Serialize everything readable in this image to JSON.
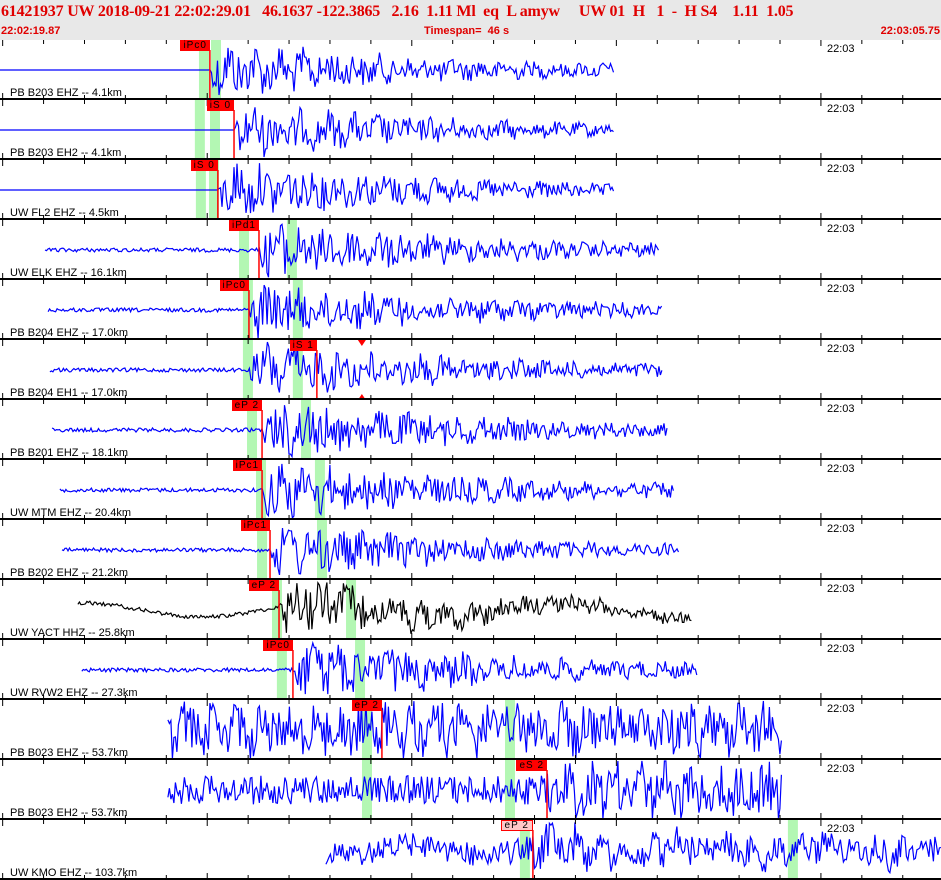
{
  "header": {
    "title": "61421937 UW 2018-09-21 22:02:29.01   46.1637 -122.3865   2.16  1.11 Ml  eq  L amyw     UW 01  H   1  -  H S4    1.11  1.05",
    "start_time": "22:02:19.87",
    "timespan": "Timespan=  46 s",
    "end_time": "22:03:05.75"
  },
  "timespan_s": 46,
  "time_label": "22:03",
  "colors": {
    "trace": "#0000ff",
    "trace_alt": "#000000",
    "pick": "#ff0000",
    "window": "#b3f7b3",
    "header_text": "#e00000"
  },
  "panels": [
    {
      "label": "PB B203 EHZ -- 4.1km",
      "pick": "iPc0",
      "pick_t": 10.26,
      "windows": [
        9.97,
        10.56
      ],
      "trace": [
        0,
        30.05
      ],
      "onset": 10.26,
      "amp": 26,
      "color": "trace"
    },
    {
      "label": "PB B203 EH2 -- 4.1km",
      "pick": "iS 0",
      "pick_t": 11.44,
      "windows": [
        9.77,
        10.51
      ],
      "trace": [
        0,
        30.05
      ],
      "onset": 11.44,
      "amp": 24,
      "color": "trace",
      "triangle": true
    },
    {
      "label": "UW FL2 EHZ -- 4.5km",
      "pick": "iS 0",
      "pick_t": 10.65,
      "windows": [
        9.82,
        10.46
      ],
      "trace": [
        0,
        30.05
      ],
      "onset": 10.65,
      "amp": 26,
      "color": "trace"
    },
    {
      "label": "UW ELK EHZ -- 16.1km",
      "pick": "iPd1",
      "pick_t": 12.66,
      "windows": [
        11.93,
        14.27
      ],
      "trace": [
        2.2,
        32.26
      ],
      "onset": 12.66,
      "amp": 26,
      "color": "trace"
    },
    {
      "label": "PB B204 EHZ -- 17.0km",
      "pick": "iPc0",
      "pick_t": 12.17,
      "windows": [
        12.12,
        14.56
      ],
      "trace": [
        2.35,
        32.36
      ],
      "onset": 12.17,
      "amp": 26,
      "color": "trace"
    },
    {
      "label": "PB B204 EH1 -- 17.0km",
      "pick": "iS 1",
      "pick_t": 15.49,
      "windows": [
        12.12,
        14.56
      ],
      "trace": [
        2.44,
        32.36
      ],
      "onset": 12.17,
      "amp": 26,
      "color": "trace",
      "triangle_t": 17.69
    },
    {
      "label": "PB B201 EHZ -- 18.1km",
      "pick": "eP 2",
      "pick_t": 12.81,
      "windows": [
        12.32,
        14.96
      ],
      "trace": [
        2.54,
        32.65
      ],
      "onset": 12.81,
      "amp": 26,
      "color": "trace"
    },
    {
      "label": "UW MTM EHZ -- 20.4km",
      "pick": "iPc1",
      "pick_t": 12.81,
      "windows": [
        12.76,
        15.64
      ],
      "trace": [
        2.93,
        32.99
      ],
      "onset": 12.81,
      "amp": 26,
      "color": "trace"
    },
    {
      "label": "PB B202 EHZ -- 21.2km",
      "pick": "iPc1",
      "pick_t": 13.2,
      "windows": [
        12.81,
        15.74
      ],
      "trace": [
        3.03,
        33.24
      ],
      "onset": 13.2,
      "amp": 24,
      "color": "trace"
    },
    {
      "label": "UW YACT HHZ -- 25.8km",
      "pick": "eP 2",
      "pick_t": 13.64,
      "windows": [
        13.54,
        17.16
      ],
      "trace": [
        3.81,
        33.82
      ],
      "onset": 13.64,
      "amp": 24,
      "color": "trace_alt"
    },
    {
      "label": "UW RVW2 EHZ -- 27.3km",
      "pick": "iPc0",
      "pick_t": 14.32,
      "windows": [
        13.78,
        17.6
      ],
      "trace": [
        4.0,
        34.07
      ],
      "onset": 14.32,
      "amp": 28,
      "color": "trace"
    },
    {
      "label": "PB B023 EHZ -- 53.7km",
      "pick": "eP 2",
      "pick_t": 18.67,
      "windows": [
        17.94,
        24.93
      ],
      "trace": [
        8.21,
        38.22
      ],
      "onset": 8.21,
      "amp": 24,
      "color": "trace"
    },
    {
      "label": "PB B023 EH2 -- 53.7km",
      "pick": "eS 2",
      "pick_t": 26.74,
      "windows": [
        17.94,
        24.93
      ],
      "trace": [
        8.21,
        38.22
      ],
      "onset": 26.74,
      "amp": 24,
      "color": "trace",
      "triangle": true
    },
    {
      "label": "UW KMO EHZ -- 103.7km",
      "pick": "eP 2",
      "pick_t": 26.05,
      "pink": true,
      "windows": [
        25.66,
        38.76
      ],
      "trace": [
        15.93,
        46
      ],
      "onset": 26.05,
      "amp": 20,
      "color": "trace"
    }
  ]
}
